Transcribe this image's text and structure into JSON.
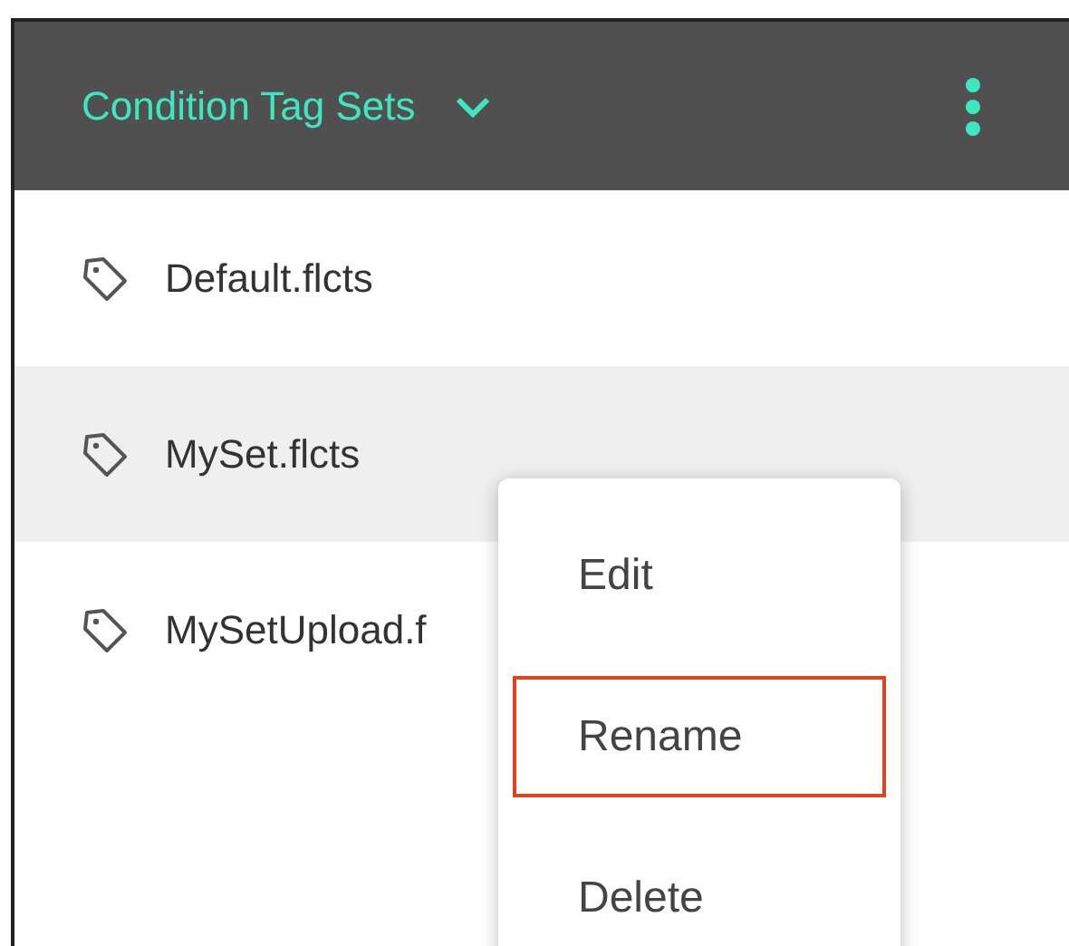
{
  "header": {
    "title": "Condition Tag Sets"
  },
  "files": [
    {
      "name": "Default.flcts",
      "selected": false
    },
    {
      "name": "MySet.flcts",
      "selected": true
    },
    {
      "name": "MySetUpload.f",
      "selected": false
    }
  ],
  "context_menu": {
    "items": [
      {
        "label": "Edit",
        "highlighted": false
      },
      {
        "label": "Rename",
        "highlighted": true
      },
      {
        "label": "Delete",
        "highlighted": false
      }
    ]
  }
}
